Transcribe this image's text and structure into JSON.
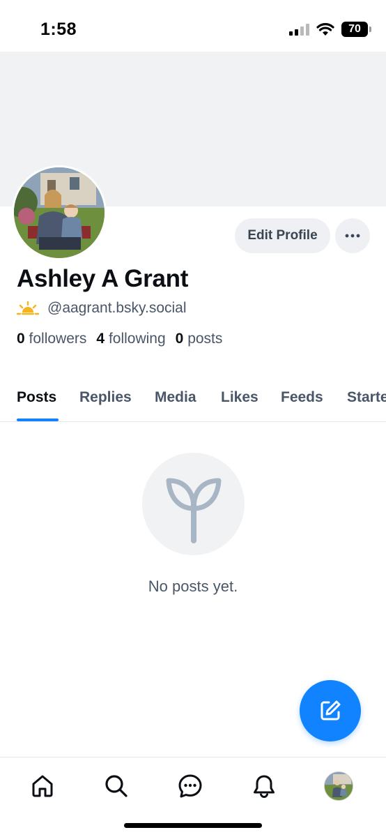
{
  "status_bar": {
    "time": "1:58",
    "battery": "70",
    "icons": [
      "cellular-signal-icon",
      "wifi-icon",
      "battery-icon"
    ]
  },
  "profile": {
    "display_name": "Ashley A Grant",
    "handle": "@aagrant.bsky.social",
    "handle_emoji_icon": "sunrise-icon",
    "edit_profile_label": "Edit Profile",
    "more_icon": "ellipsis-icon",
    "stats": {
      "followers_count": "0",
      "followers_label": "followers",
      "following_count": "4",
      "following_label": "following",
      "posts_count": "0",
      "posts_label": "posts"
    }
  },
  "tabs": [
    {
      "label": "Posts",
      "active": true
    },
    {
      "label": "Replies",
      "active": false
    },
    {
      "label": "Media",
      "active": false
    },
    {
      "label": "Likes",
      "active": false
    },
    {
      "label": "Feeds",
      "active": false
    },
    {
      "label": "Starter Packs",
      "active": false
    }
  ],
  "empty_state": {
    "icon": "seedling-icon",
    "text": "No posts yet."
  },
  "fab": {
    "icon": "compose-icon"
  },
  "bottom_nav": {
    "items": [
      "home-icon",
      "search-icon",
      "chat-icon",
      "bell-icon",
      "profile-avatar"
    ]
  },
  "colors": {
    "accent": "#1083fe",
    "banner": "#f1f2f4",
    "muted_text": "#4a5668"
  }
}
